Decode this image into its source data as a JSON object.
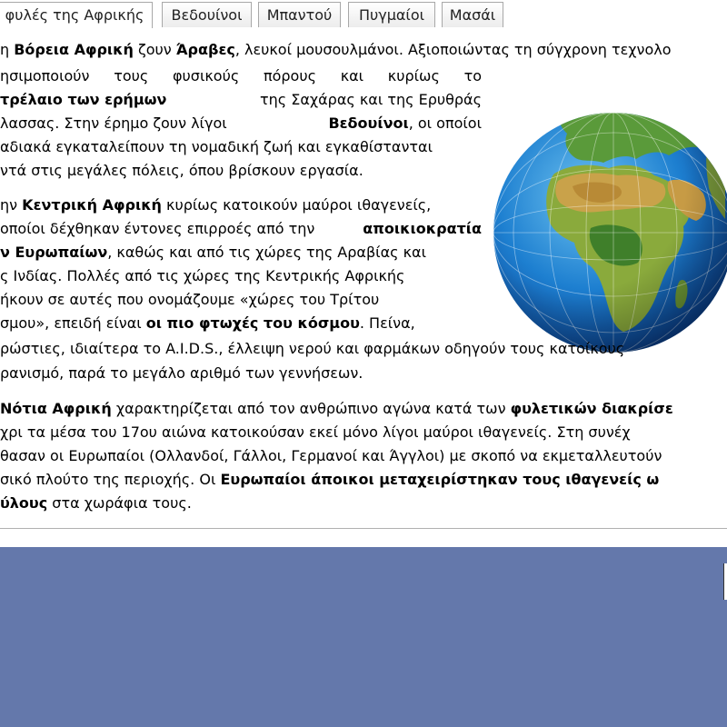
{
  "tabs": [
    {
      "label": "φυλές της Αφρικής",
      "active": true
    },
    {
      "label": "Βεδουίνοι",
      "active": false
    },
    {
      "label": "Μπαντού",
      "active": false
    },
    {
      "label": "Πυγμαίοι",
      "active": false
    },
    {
      "label": "Μασάι",
      "active": false
    }
  ],
  "paragraphs": {
    "p1": {
      "l1": {
        "a": "η ",
        "b1": "Βόρεια Αφρική",
        "c": " ζουν ",
        "b2": "Άραβες",
        "d": ", λευκοί μουσουλμάνοι. Αξιοποιώντας τη σύγχρονη τεχνολο"
      },
      "l2": {
        "a": "ησιμοποιούν τους φυσικούς πόρους και κυρίως το"
      },
      "l3": {
        "b1": "τρέλαιο των ερήμων",
        "a": " της Σαχάρας και της Ερυθράς"
      },
      "l4": {
        "a": "λασσας. Στην έρημο ζουν λίγοι ",
        "b1": "Βεδουίνοι",
        "c": ", οι οποίοι"
      },
      "l5": {
        "a": "αδιακά εγκαταλείπουν τη νομαδική ζωή και εγκαθίστανται"
      },
      "l6": {
        "a": "ντά στις μεγάλες πόλεις, όπου βρίσκουν εργασία."
      }
    },
    "p2": {
      "l1": {
        "a": "ην ",
        "b1": "Κεντρική Αφρική",
        "c": " κυρίως κατοικούν μαύροι ιθαγενείς,"
      },
      "l2": {
        "a": "οποίοι δέχθηκαν έντονες επιρροές από την ",
        "b1": "αποικιοκρατία"
      },
      "l3": {
        "b1": "ν Ευρωπαίων",
        "a": ", καθώς και από τις χώρες της Αραβίας και"
      },
      "l4": {
        "a": "ς Ινδίας. Πολλές από τις χώρες της Κεντρικής Αφρικής"
      },
      "l5": {
        "a": "ήκουν σε αυτές που ονομάζουμε «χώρες του Τρίτου"
      },
      "l6": {
        "a": "σμου», επειδή είναι ",
        "b1": "οι πιο φτωχές του κόσμου",
        "c": ". Πείνα,"
      },
      "l7": {
        "a": "ρώστιες, ιδιαίτερα το A.I.D.S., έλλειψη νερού και φαρμάκων οδηγούν τους κατοίκους"
      },
      "l8": {
        "a": "ρανισμό, παρά το μεγάλο αριθμό των γεννήσεων."
      }
    },
    "p3": {
      "l1": {
        "b1": "Νότια Αφρική",
        "a": " χαρακτηρίζεται από τον ανθρώπινο αγώνα κατά των ",
        "b2": "φυλετικών διακρίσε"
      },
      "l2": {
        "a": "χρι τα μέσα του 17ου αιώνα κατοικούσαν εκεί μόνο λίγοι μαύροι ιθαγενείς. Στη συνέχ"
      },
      "l3": {
        "a": "θασαν οι Ευρωπαίοι (Ολλανδοί, Γάλλοι, Γερμανοί και Άγγλοι) με σκοπό να εκμεταλλευτούν"
      },
      "l4": {
        "a": "σικό πλούτο της περιοχής. Οι ",
        "b1": "Ευρωπαίοι άποικοι μεταχειρίστηκαν τους ιθαγενείς ω"
      },
      "l5": {
        "b1": "ύλους",
        "a": " στα χωράφια τους."
      }
    }
  },
  "image": {
    "icon": "globe-africa-icon"
  },
  "colors": {
    "footer": "#6478ab",
    "tab_border": "#a8a8a8"
  }
}
